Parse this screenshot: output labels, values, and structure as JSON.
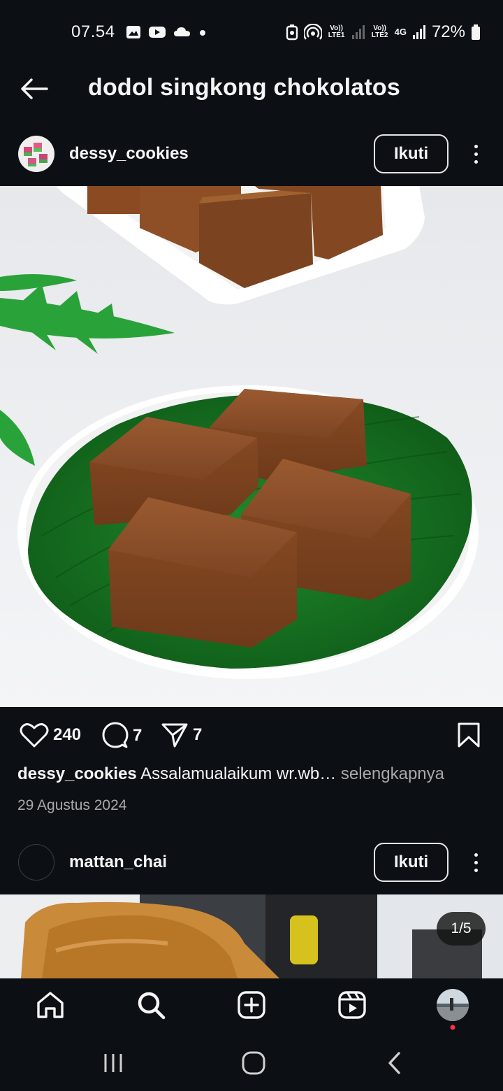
{
  "status_bar": {
    "time": "07.54",
    "left_icons": [
      "gallery-icon",
      "youtube-icon",
      "cloud-icon",
      "dot-icon"
    ],
    "sim1": "Vo)) LTE1",
    "sim2": "Vo)) LTE2",
    "network": "4G",
    "battery": "72%"
  },
  "header": {
    "back_icon": "arrow-left-icon",
    "title": "dodol singkong chokolatos"
  },
  "posts": [
    {
      "username": "dessy_cookies",
      "follow_label": "Ikuti",
      "likes": "240",
      "comments": "7",
      "shares": "7",
      "caption": "Assalamualaikum wr.wb…",
      "see_more": "selengkapnya",
      "date": "29 Agustus 2024"
    },
    {
      "username": "mattan_chai",
      "follow_label": "Ikuti",
      "carousel_counter": "1/5"
    }
  ],
  "bottom_nav": [
    "home-icon",
    "search-icon",
    "create-icon",
    "reels-icon",
    "profile-avatar"
  ],
  "system_nav": [
    "recent-apps-icon",
    "home-circle-icon",
    "back-chevron-icon"
  ],
  "colors": {
    "background": "#0c1014",
    "text": "#f5f5f5",
    "muted": "#a8a8a8",
    "notification_dot": "#ff3040"
  }
}
